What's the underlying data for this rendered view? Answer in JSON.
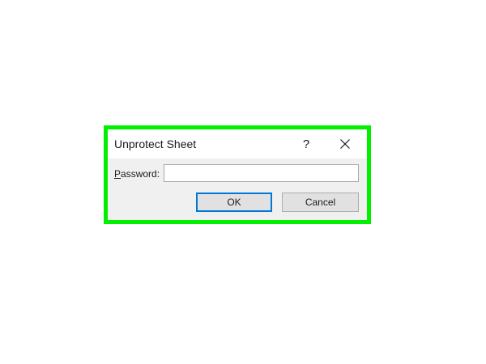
{
  "dialog": {
    "title": "Unprotect Sheet",
    "help_label": "?",
    "close_icon": "close-icon",
    "password_label_accel": "P",
    "password_label_rest": "assword:",
    "password_value": "",
    "ok_label": "OK",
    "cancel_label": "Cancel"
  },
  "colors": {
    "highlight": "#00f000",
    "dialog_bg": "#f0f0f0",
    "titlebar_bg": "#ffffff",
    "default_button_border": "#0078d7"
  }
}
